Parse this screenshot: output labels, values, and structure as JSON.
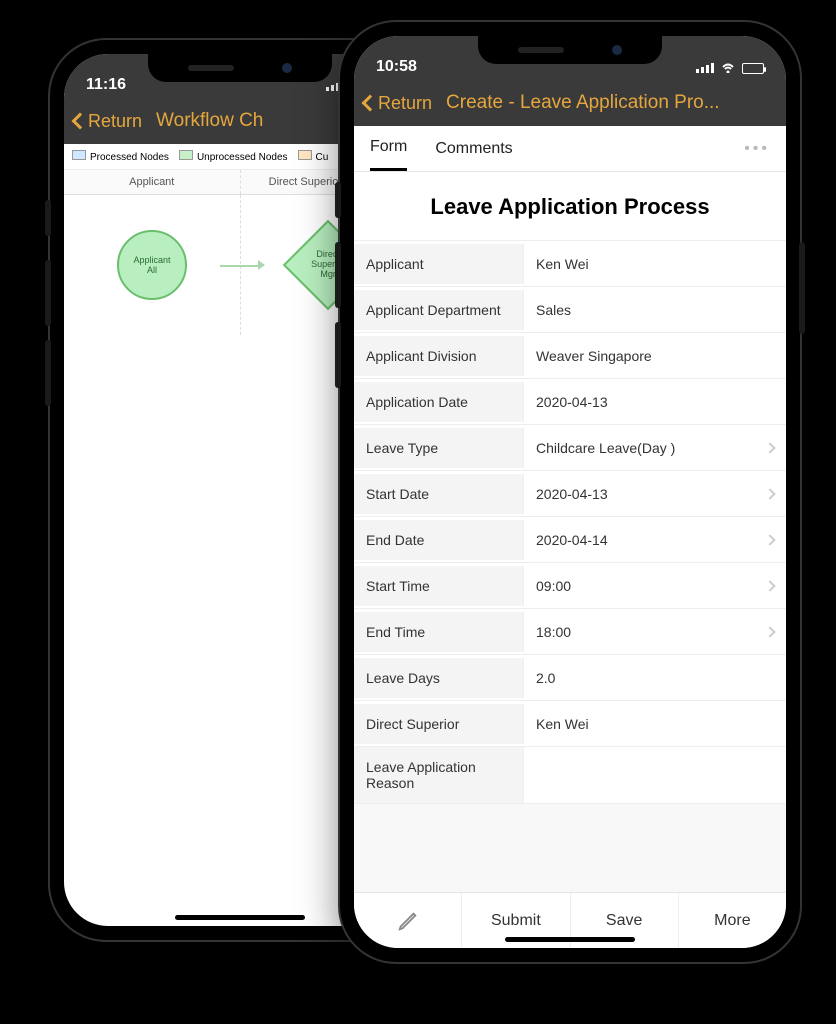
{
  "phone1": {
    "status_time": "11:16",
    "nav_back": "Return",
    "nav_title": "Workflow Ch",
    "legend": {
      "processed": "Processed Nodes",
      "unprocessed": "Unprocessed Nodes",
      "current_prefix": "Cu"
    },
    "lanes": {
      "applicant": "Applicant",
      "superior": "Direct Superior Approval"
    },
    "nodes": {
      "applicant": {
        "label": "Applicant",
        "sub": "All"
      },
      "superior": {
        "label": "Direct Superior",
        "sub": "Mgr"
      }
    }
  },
  "phone2": {
    "status_time": "10:58",
    "nav_back": "Return",
    "nav_title": "Create  - Leave Application Pro...",
    "tabs": {
      "form": "Form",
      "comments": "Comments"
    },
    "section_title": "Leave Application Process",
    "rows": [
      {
        "label": "Applicant",
        "value": "Ken Wei",
        "selectable": false
      },
      {
        "label": "Applicant Department",
        "value": "Sales",
        "selectable": false
      },
      {
        "label": "Applicant Division",
        "value": "Weaver Singapore",
        "selectable": false
      },
      {
        "label": "Application Date",
        "value": "2020-04-13",
        "selectable": false
      },
      {
        "label": "Leave Type",
        "value": "Childcare Leave(Day )",
        "selectable": true
      },
      {
        "label": "Start Date",
        "value": "2020-04-13",
        "selectable": true
      },
      {
        "label": "End Date",
        "value": "2020-04-14",
        "selectable": true
      },
      {
        "label": "Start Time",
        "value": "09:00",
        "selectable": true
      },
      {
        "label": "End Time",
        "value": "18:00",
        "selectable": true
      },
      {
        "label": "Leave Days",
        "value": "2.0",
        "selectable": false
      },
      {
        "label": "Direct Superior",
        "value": "Ken Wei",
        "selectable": false
      },
      {
        "label": "Leave Application Reason",
        "value": "",
        "selectable": false
      }
    ],
    "bottom": {
      "submit": "Submit",
      "save": "Save",
      "more": "More"
    }
  }
}
